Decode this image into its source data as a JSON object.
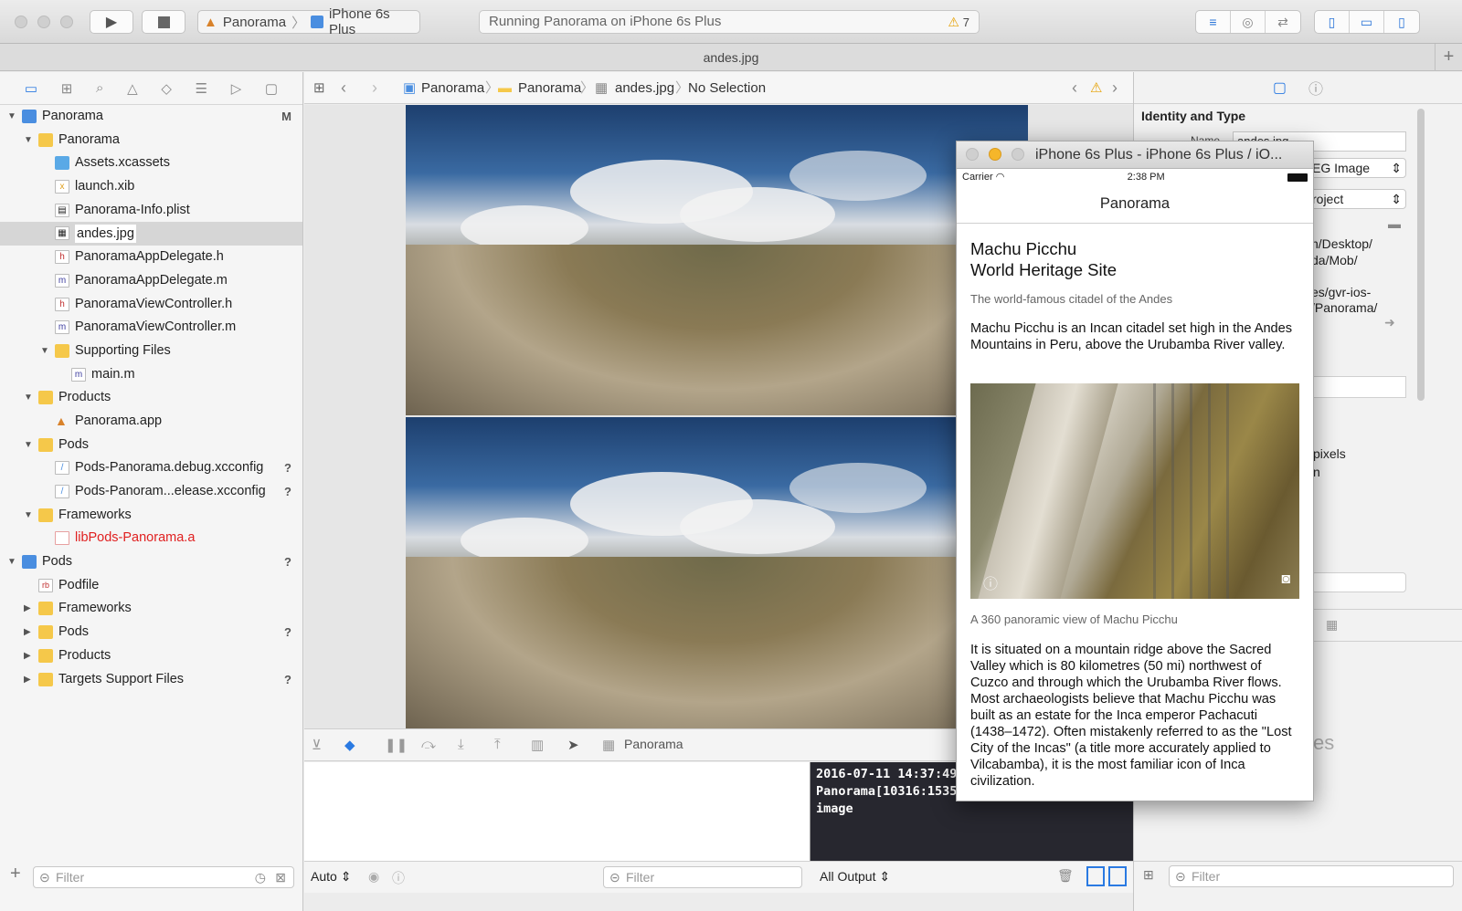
{
  "toolbar": {
    "scheme_project": "Panorama",
    "scheme_device": "iPhone 6s Plus",
    "activity": "Running Panorama on iPhone 6s Plus",
    "warning_count": "7"
  },
  "tab": {
    "title": "andes.jpg"
  },
  "navigator": {
    "items": [
      {
        "label": "Panorama",
        "flag": "M"
      },
      {
        "label": "Panorama"
      },
      {
        "label": "Assets.xcassets"
      },
      {
        "label": "launch.xib"
      },
      {
        "label": "Panorama-Info.plist"
      },
      {
        "label": "andes.jpg"
      },
      {
        "label": "PanoramaAppDelegate.h"
      },
      {
        "label": "PanoramaAppDelegate.m"
      },
      {
        "label": "PanoramaViewController.h"
      },
      {
        "label": "PanoramaViewController.m"
      },
      {
        "label": "Supporting Files"
      },
      {
        "label": "main.m"
      },
      {
        "label": "Products"
      },
      {
        "label": "Panorama.app"
      },
      {
        "label": "Pods"
      },
      {
        "label": "Pods-Panorama.debug.xcconfig",
        "flag": "?"
      },
      {
        "label": "Pods-Panoram...elease.xcconfig",
        "flag": "?"
      },
      {
        "label": "Frameworks"
      },
      {
        "label": "libPods-Panorama.a"
      },
      {
        "label": "Pods",
        "flag": "?"
      },
      {
        "label": "Podfile"
      },
      {
        "label": "Frameworks"
      },
      {
        "label": "Pods",
        "flag": "?"
      },
      {
        "label": "Products"
      },
      {
        "label": "Targets Support Files",
        "flag": "?"
      }
    ],
    "filter_placeholder": "Filter"
  },
  "jumpbar": {
    "crumbs": [
      "Panorama",
      "Panorama",
      "andes.jpg",
      "No Selection"
    ]
  },
  "inspector": {
    "section_title": "Identity and Type",
    "name_label": "Name",
    "name_value": "andes.jpg",
    "type_value": "EG Image",
    "location_value": "roject",
    "path_lines": [
      "n/Desktop/",
      "da/Mob/",
      "es/gvr-ios-",
      "/Panorama/"
    ],
    "pixels": "pixels",
    "n_text": "n",
    "es_text": "es",
    "filter_placeholder": "Filter"
  },
  "debug": {
    "process": "Panorama",
    "auto_label": "Auto",
    "filter_placeholder": "Filter",
    "output_label": "All Output",
    "console_lines": [
      "2016-07-11 14:37:49",
      "Panorama[10316:1535",
      "image"
    ]
  },
  "simulator": {
    "window_title": "iPhone 6s Plus - iPhone 6s Plus / iO...",
    "carrier": "Carrier",
    "time": "2:38 PM",
    "nav_title": "Panorama",
    "heading_line1": "Machu Picchu",
    "heading_line2": "World Heritage Site",
    "subtitle": "The world-famous citadel of the Andes",
    "para1": "Machu Picchu is an Incan citadel set high in the Andes Mountains in Peru, above the Urubamba River valley.",
    "caption": "A 360 panoramic view of Machu Picchu",
    "para2": "It is situated on a mountain ridge above the Sacred Valley which is 80 kilometres (50 mi) northwest of Cuzco and through which the Urubamba River flows. Most archaeologists believe that Machu Picchu was built as an estate for the Inca emperor Pachacuti (1438–1472). Often mistakenly referred to as the \"Lost City of the Incas\" (a title more accurately applied to Vilcabamba), it is the most familiar icon of Inca civilization."
  },
  "colors": {
    "accent": "#2a7ae2",
    "warning": "#e6a000",
    "missing_file": "#e02020"
  }
}
